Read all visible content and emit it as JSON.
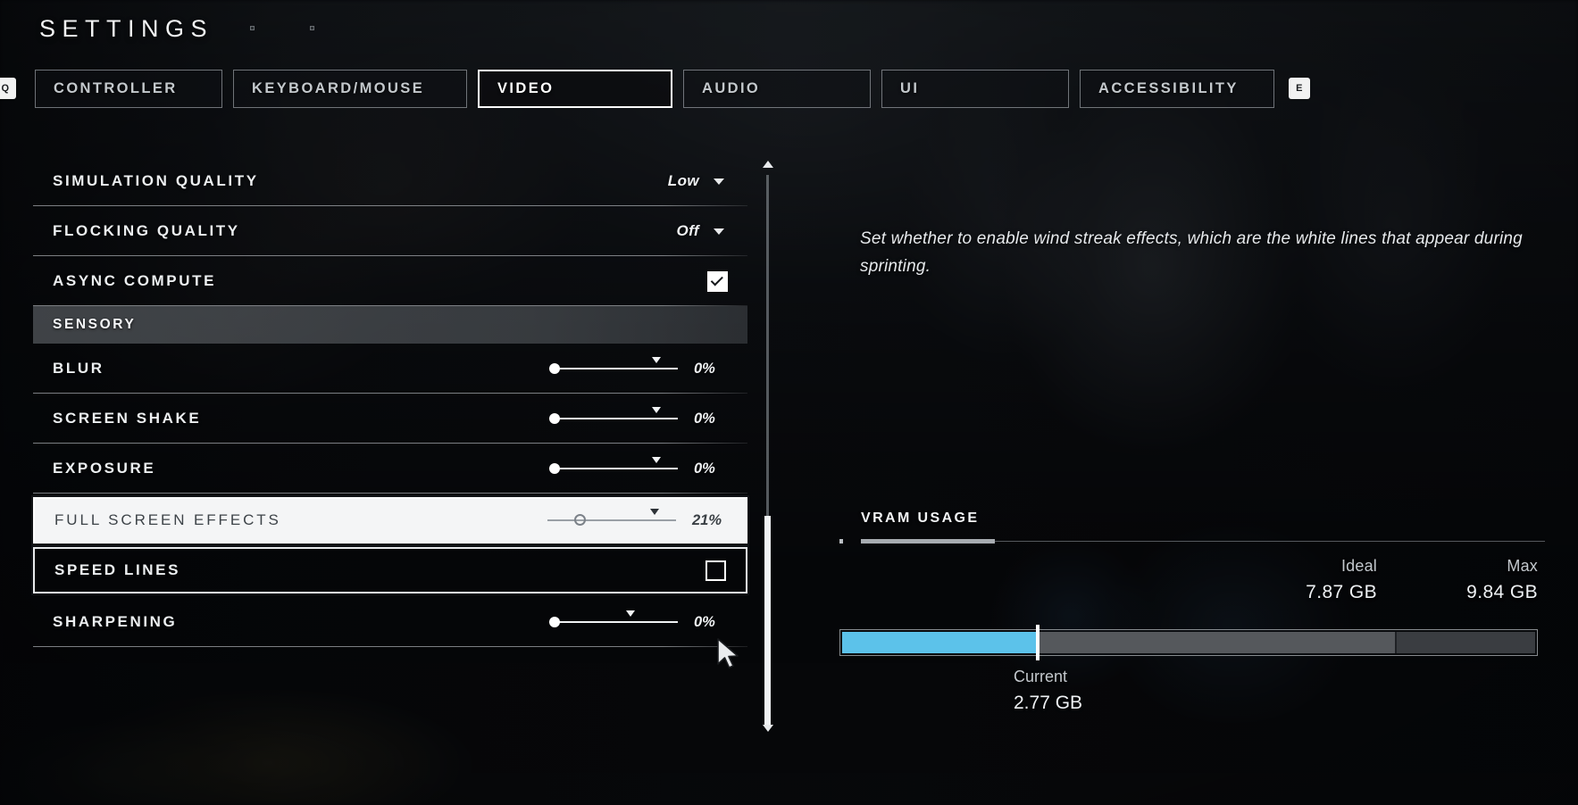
{
  "header": {
    "title": "SETTINGS",
    "key_left": "Q",
    "key_right": "E"
  },
  "tabs": [
    {
      "label": "CONTROLLER",
      "active": false
    },
    {
      "label": "KEYBOARD/MOUSE",
      "active": false
    },
    {
      "label": "VIDEO",
      "active": true
    },
    {
      "label": "AUDIO",
      "active": false
    },
    {
      "label": "UI",
      "active": false
    },
    {
      "label": "ACCESSIBILITY",
      "active": false
    }
  ],
  "settings": [
    {
      "label": "SIMULATION QUALITY",
      "type": "dropdown",
      "value": "Low"
    },
    {
      "label": "FLOCKING QUALITY",
      "type": "dropdown",
      "value": "Off"
    },
    {
      "label": "ASYNC COMPUTE",
      "type": "checkbox",
      "checked": true
    },
    {
      "label": "SENSORY",
      "type": "section"
    },
    {
      "label": "BLUR",
      "type": "slider",
      "value": "0%",
      "fill": 0,
      "mark": 80
    },
    {
      "label": "SCREEN SHAKE",
      "type": "slider",
      "value": "0%",
      "fill": 0,
      "mark": 80
    },
    {
      "label": "EXPOSURE",
      "type": "slider",
      "value": "0%",
      "fill": 0,
      "mark": 80
    },
    {
      "label": "FULL SCREEN EFFECTS",
      "type": "slider",
      "value": "21%",
      "fill": 21,
      "mark": 80,
      "state": "selected"
    },
    {
      "label": "SPEED LINES",
      "type": "checkbox",
      "checked": false,
      "state": "outlined"
    },
    {
      "label": "SHARPENING",
      "type": "slider",
      "value": "0%",
      "fill": 0,
      "mark": 60
    }
  ],
  "description": "Set whether to enable wind streak effects, which are the white lines that appear during sprinting.",
  "vram": {
    "title": "VRAM USAGE",
    "ideal_label": "Ideal",
    "ideal_value": "7.87 GB",
    "max_label": "Max",
    "max_value": "9.84 GB",
    "current_label": "Current",
    "current_value": "2.77 GB",
    "current_pct": 28,
    "ideal_pct": 80,
    "accent_color": "#5cc2ea"
  },
  "scrollbar": {
    "up_arrow": "scroll-up",
    "down_arrow": "scroll-down",
    "thumb_top_pct": 62,
    "thumb_height_pct": 37
  }
}
